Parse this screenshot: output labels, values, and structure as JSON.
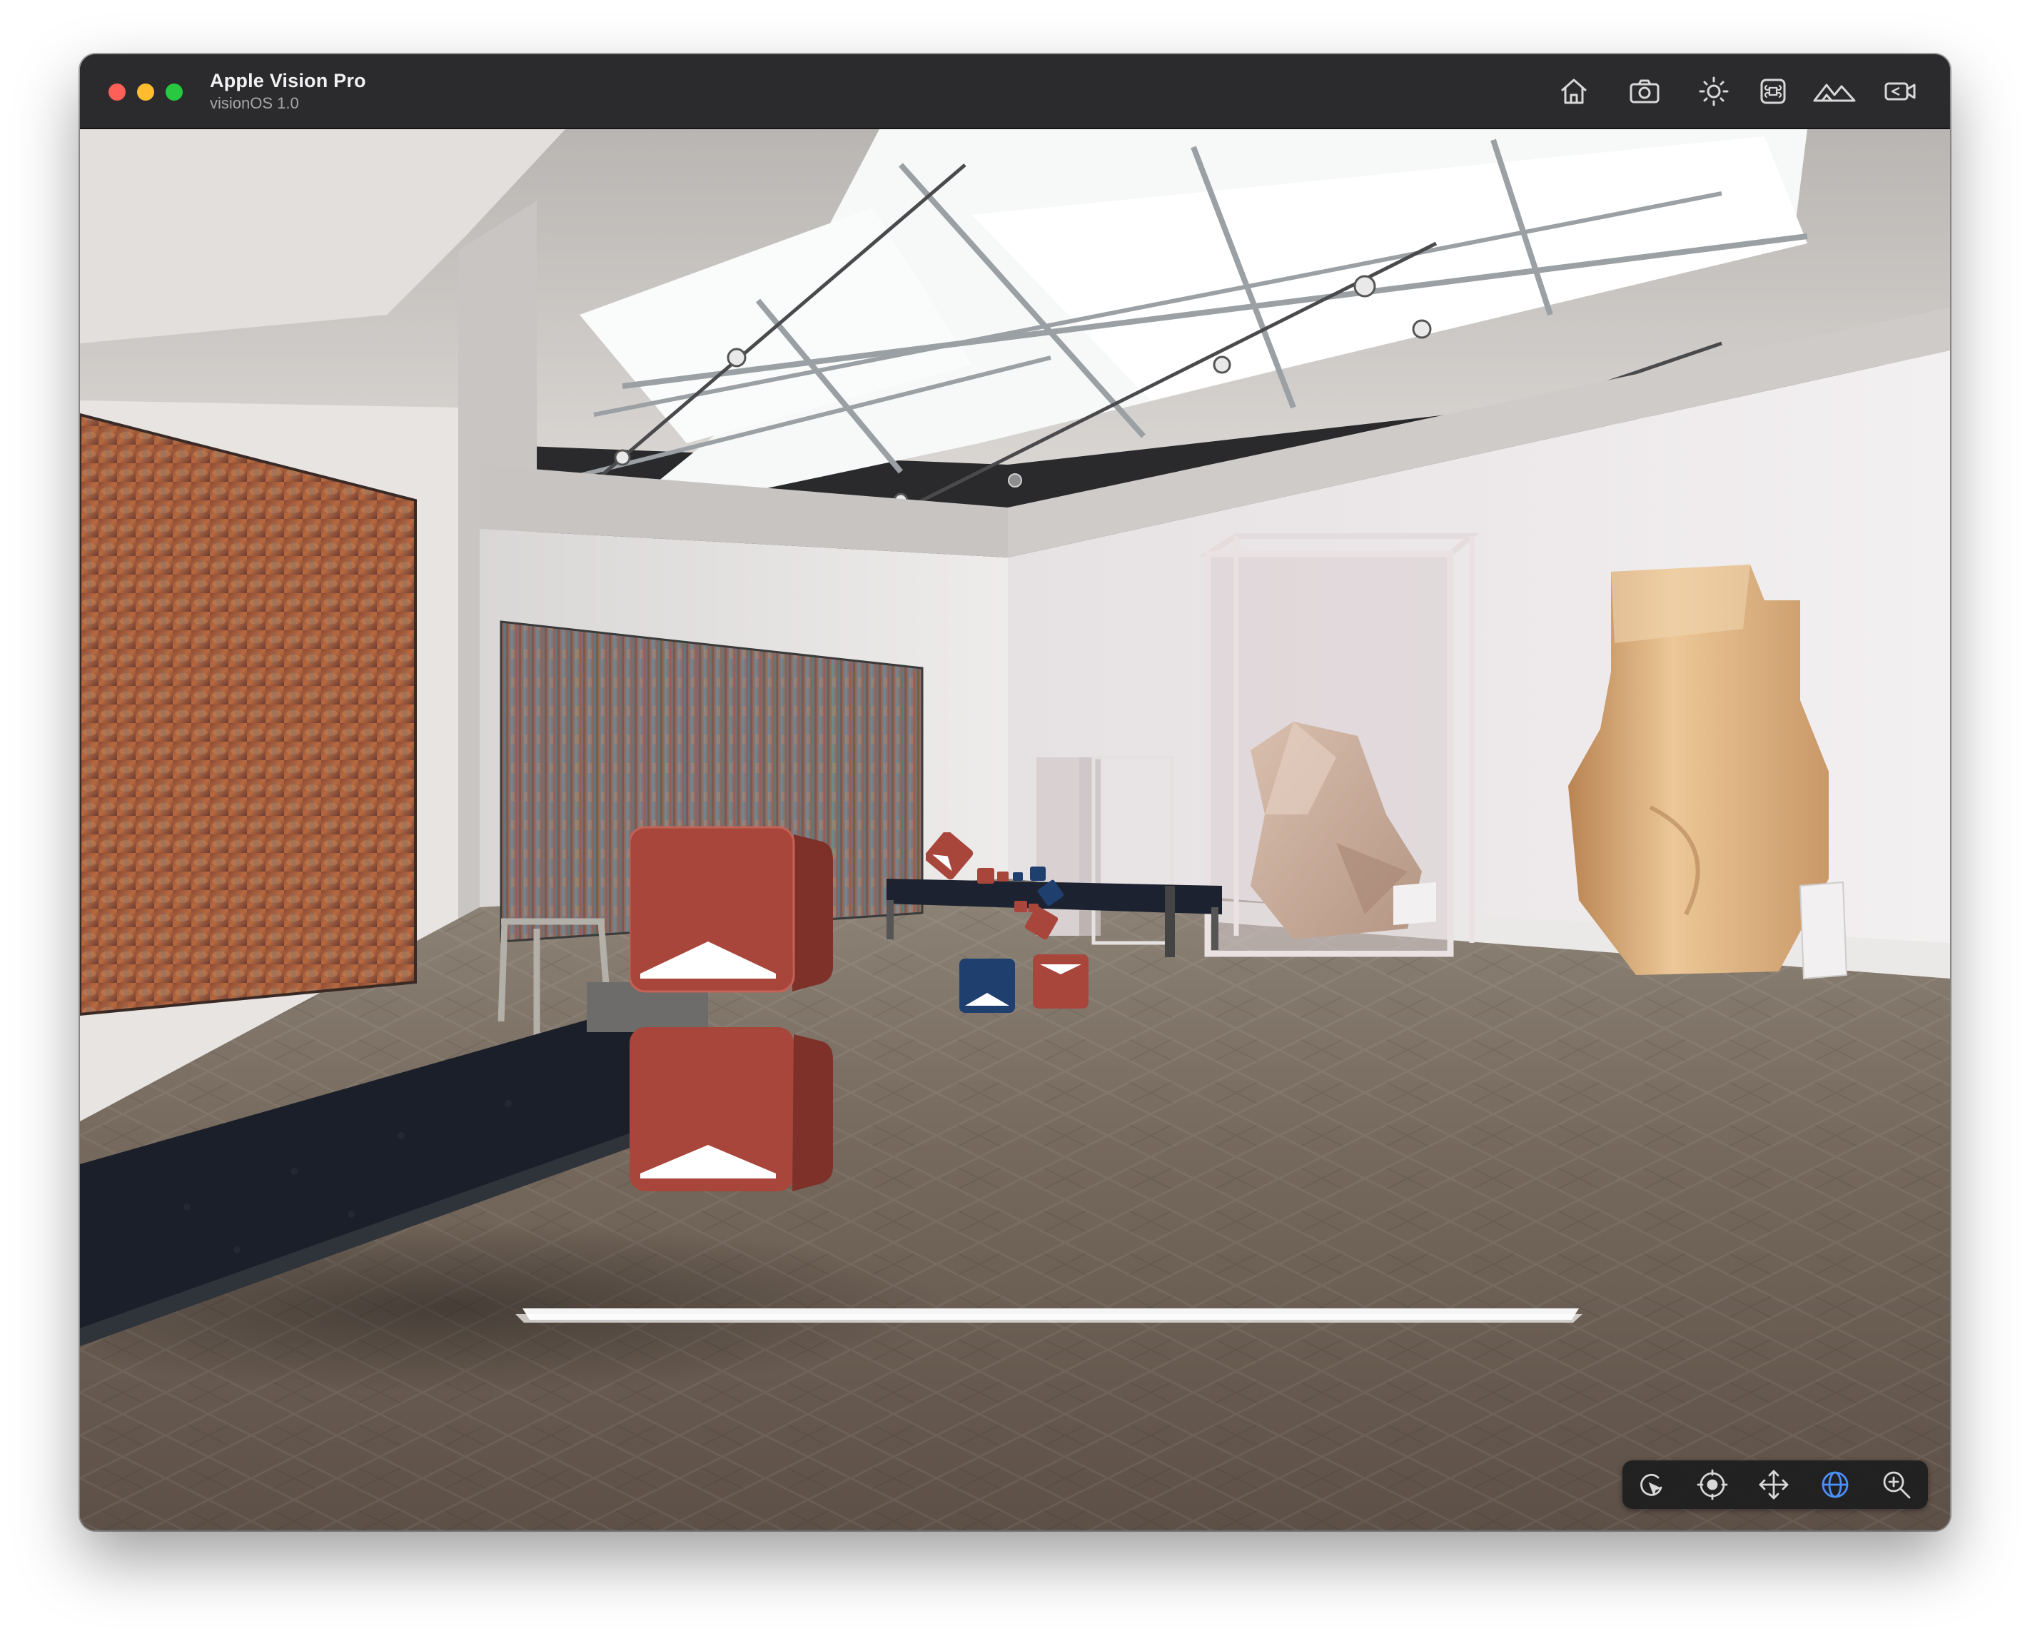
{
  "window": {
    "title": "Apple Vision Pro",
    "subtitle": "visionOS 1.0"
  },
  "toolbar_icons": [
    "home-icon",
    "camera-icon",
    "brightness-icon",
    "command-key-icon",
    "environment-mountain-icon",
    "record-video-icon"
  ],
  "sim_toolbar": {
    "buttons": [
      "select-pointer-icon",
      "look-around-icon",
      "pan-move-icon",
      "orbit-globe-icon",
      "zoom-icon"
    ],
    "active": "orbit-globe-icon",
    "active_color": "#4a90ff"
  },
  "scene": {
    "description_tag": "immersive-gallery-environment",
    "cube_colors": {
      "red": "#a9463c",
      "blue": "#1f3f6e",
      "face": "#ffffff"
    }
  }
}
